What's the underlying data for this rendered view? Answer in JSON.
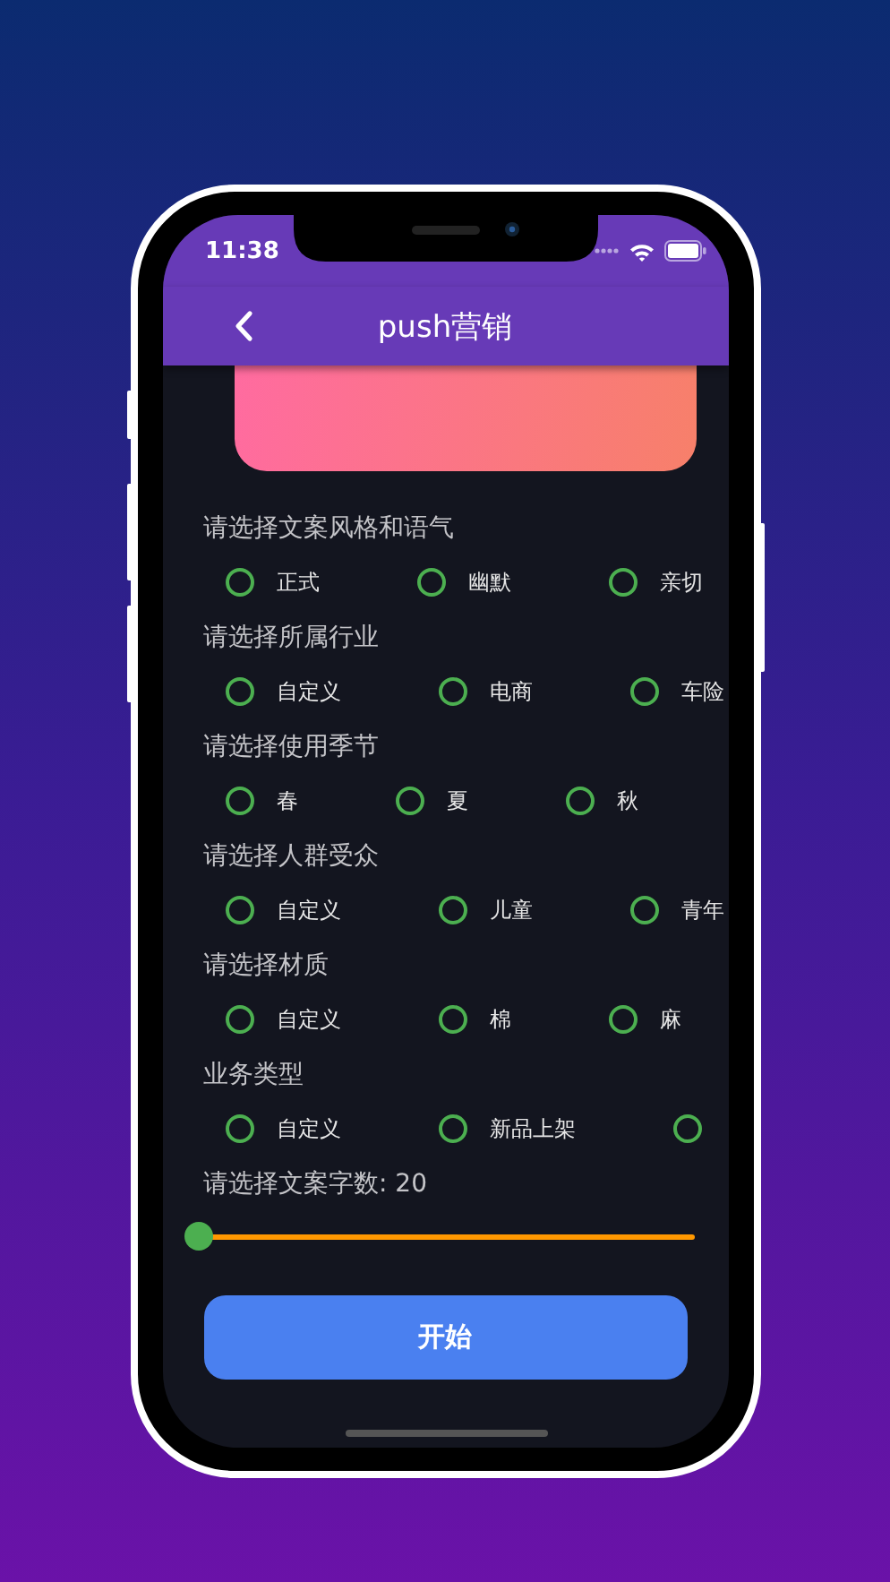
{
  "status_bar": {
    "time": "11:38"
  },
  "app_bar": {
    "title": "push营销"
  },
  "sections": [
    {
      "label": "请选择文案风格和语气",
      "options": [
        {
          "label": "正式",
          "selected": false
        },
        {
          "label": "幽默",
          "selected": false
        },
        {
          "label": "亲切",
          "selected": false
        }
      ]
    },
    {
      "label": "请选择所属行业",
      "options": [
        {
          "label": "自定义",
          "selected": false
        },
        {
          "label": "电商",
          "selected": false
        },
        {
          "label": "车险",
          "selected": false
        }
      ]
    },
    {
      "label": "请选择使用季节",
      "options": [
        {
          "label": "春",
          "selected": false
        },
        {
          "label": "夏",
          "selected": false
        },
        {
          "label": "秋",
          "selected": false
        }
      ]
    },
    {
      "label": "请选择人群受众",
      "options": [
        {
          "label": "自定义",
          "selected": false
        },
        {
          "label": "儿童",
          "selected": false
        },
        {
          "label": "青年",
          "selected": false
        }
      ]
    },
    {
      "label": "请选择材质",
      "options": [
        {
          "label": "自定义",
          "selected": false
        },
        {
          "label": "棉",
          "selected": false
        },
        {
          "label": "麻",
          "selected": false
        }
      ]
    },
    {
      "label": "业务类型",
      "options": [
        {
          "label": "自定义",
          "selected": false
        },
        {
          "label": "新品上架",
          "selected": false
        },
        {
          "selected": false
        }
      ]
    }
  ],
  "word_count": {
    "label": "请选择文案字数: 20",
    "level": 0
  },
  "start_button": {
    "label": "开始"
  }
}
